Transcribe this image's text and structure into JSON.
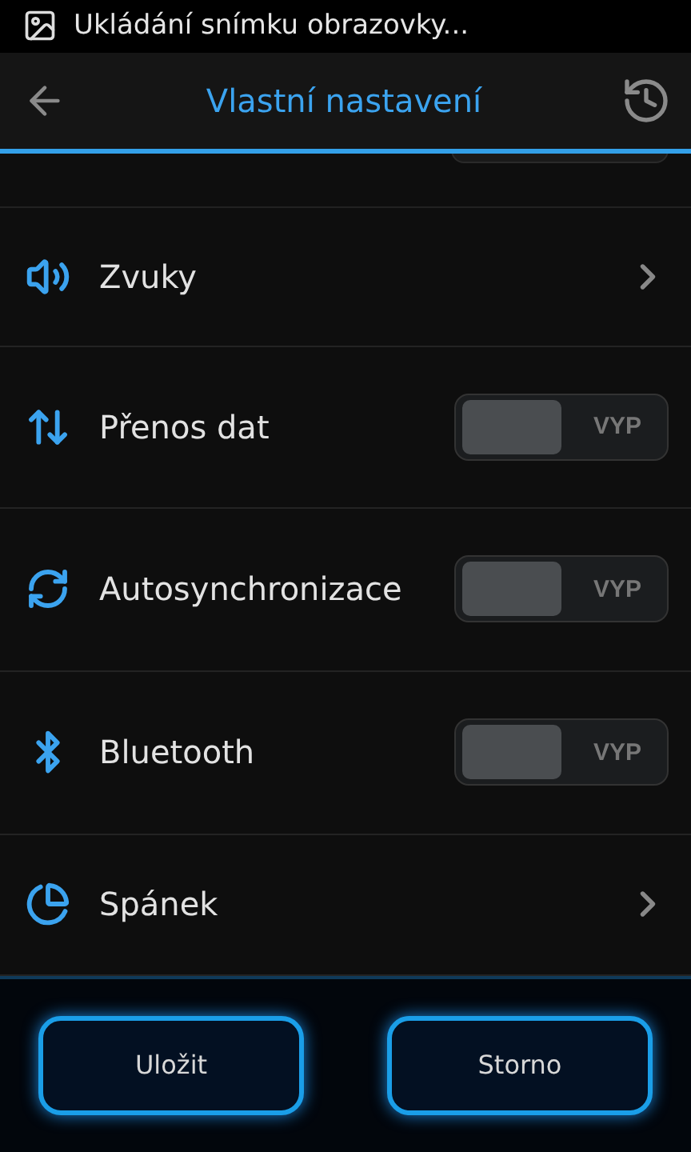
{
  "status_bar": {
    "notification": "Ukládání snímku obrazovky..."
  },
  "action_bar": {
    "title": "Vlastní nastavení"
  },
  "settings": [
    {
      "kind": "link",
      "label": "Zvuky"
    },
    {
      "kind": "toggle",
      "label": "Přenos dat",
      "on": false,
      "state_text": "VYP"
    },
    {
      "kind": "toggle",
      "label": "Autosynchronizace",
      "on": false,
      "state_text": "VYP"
    },
    {
      "kind": "toggle",
      "label": "Bluetooth",
      "on": false,
      "state_text": "VYP"
    },
    {
      "kind": "link",
      "label": "Spánek"
    }
  ],
  "buttons": [
    "Uložit",
    "Storno"
  ]
}
